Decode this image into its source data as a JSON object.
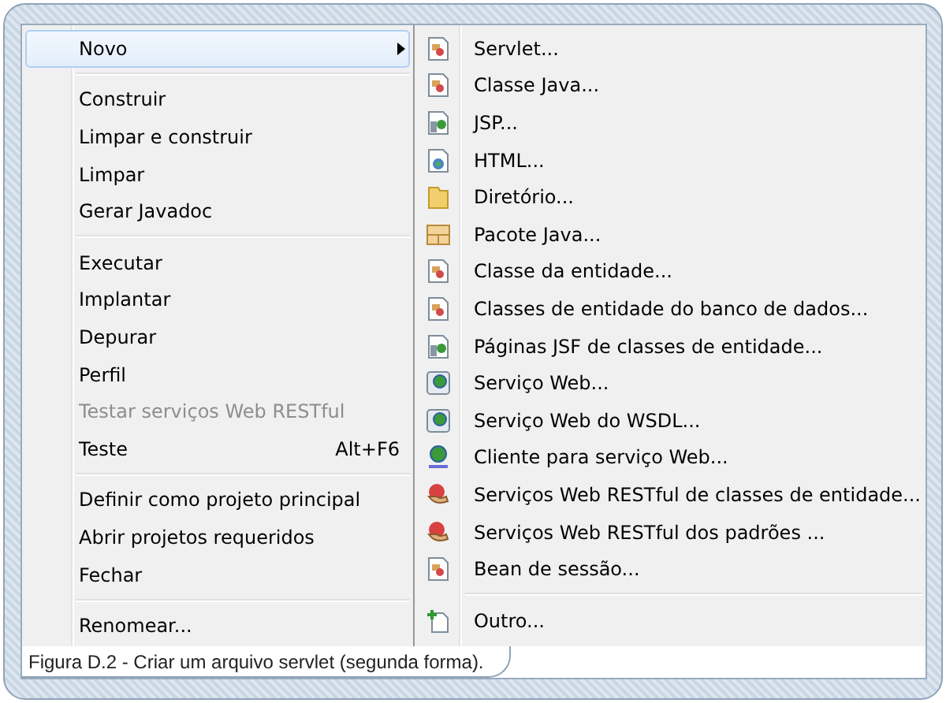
{
  "context_menu": {
    "items": [
      {
        "kind": "item",
        "label": "Novo",
        "selected": true,
        "disabled": false,
        "submenu": true
      },
      {
        "kind": "separator"
      },
      {
        "kind": "item",
        "label": "Construir",
        "selected": false,
        "disabled": false,
        "submenu": false
      },
      {
        "kind": "item",
        "label": "Limpar e construir",
        "selected": false,
        "disabled": false,
        "submenu": false
      },
      {
        "kind": "item",
        "label": "Limpar",
        "selected": false,
        "disabled": false,
        "submenu": false
      },
      {
        "kind": "item",
        "label": "Gerar Javadoc",
        "selected": false,
        "disabled": false,
        "submenu": false
      },
      {
        "kind": "separator"
      },
      {
        "kind": "item",
        "label": "Executar",
        "selected": false,
        "disabled": false,
        "submenu": false
      },
      {
        "kind": "item",
        "label": "Implantar",
        "selected": false,
        "disabled": false,
        "submenu": false
      },
      {
        "kind": "item",
        "label": "Depurar",
        "selected": false,
        "disabled": false,
        "submenu": false
      },
      {
        "kind": "item",
        "label": "Perfil",
        "selected": false,
        "disabled": false,
        "submenu": false
      },
      {
        "kind": "item",
        "label": "Testar serviços Web RESTful",
        "selected": false,
        "disabled": true,
        "submenu": false
      },
      {
        "kind": "item",
        "label": "Teste",
        "selected": false,
        "disabled": false,
        "submenu": false,
        "shortcut": "Alt+F6"
      },
      {
        "kind": "separator"
      },
      {
        "kind": "item",
        "label": "Definir como projeto principal",
        "selected": false,
        "disabled": false,
        "submenu": false
      },
      {
        "kind": "item",
        "label": "Abrir projetos requeridos",
        "selected": false,
        "disabled": false,
        "submenu": false
      },
      {
        "kind": "item",
        "label": "Fechar",
        "selected": false,
        "disabled": false,
        "submenu": false
      },
      {
        "kind": "separator"
      },
      {
        "kind": "item",
        "label": "Renomear...",
        "selected": false,
        "disabled": false,
        "submenu": false
      }
    ]
  },
  "submenu": {
    "items": [
      {
        "kind": "class",
        "label": "Servlet..."
      },
      {
        "kind": "class",
        "label": "Classe Java..."
      },
      {
        "kind": "jsp",
        "label": "JSP..."
      },
      {
        "kind": "html",
        "label": "HTML..."
      },
      {
        "kind": "folder",
        "label": "Diretório..."
      },
      {
        "kind": "package",
        "label": "Pacote Java..."
      },
      {
        "kind": "class",
        "label": "Classe da entidade..."
      },
      {
        "kind": "class",
        "label": "Classes de entidade do banco de dados..."
      },
      {
        "kind": "jsp",
        "label": "Páginas JSF de classes de entidade..."
      },
      {
        "kind": "webservice",
        "label": "Serviço Web..."
      },
      {
        "kind": "webservice",
        "label": "Serviço Web do WSDL..."
      },
      {
        "kind": "client",
        "label": "Cliente para serviço Web..."
      },
      {
        "kind": "rest",
        "label": "Serviços Web RESTful de classes de entidade..."
      },
      {
        "kind": "rest",
        "label": "Serviços Web RESTful dos padrões ..."
      },
      {
        "kind": "bean",
        "label": "Bean de sessão..."
      },
      {
        "kind": "separator"
      },
      {
        "kind": "new",
        "label": "Outro..."
      }
    ]
  },
  "caption": "Figura D.2 - Criar um arquivo servlet (segunda forma)."
}
